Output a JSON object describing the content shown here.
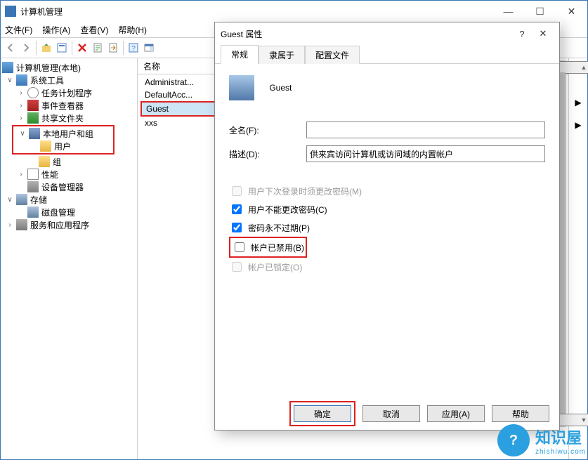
{
  "window": {
    "title": "计算机管理",
    "menus": [
      "文件(F)",
      "操作(A)",
      "查看(V)",
      "帮助(H)"
    ]
  },
  "tree": {
    "root": "计算机管理(本地)",
    "system_tools": "系统工具",
    "task_scheduler": "任务计划程序",
    "event_viewer": "事件查看器",
    "shared_folders": "共享文件夹",
    "local_users_groups": "本地用户和组",
    "users": "用户",
    "groups": "组",
    "performance": "性能",
    "device_manager": "设备管理器",
    "storage": "存储",
    "disk_management": "磁盘管理",
    "services_apps": "服务和应用程序"
  },
  "list": {
    "header_name": "名称",
    "items": [
      "Administrat...",
      "DefaultAcc...",
      "Guest",
      "xxs"
    ],
    "selected": "Guest"
  },
  "dialog": {
    "title": "Guest 属性",
    "tabs": [
      "常规",
      "隶属于",
      "配置文件"
    ],
    "hero_name": "Guest",
    "full_name_label": "全名(F):",
    "full_name_value": "",
    "description_label": "描述(D):",
    "description_value": "供来宾访问计算机或访问域的内置帐户",
    "checks": {
      "must_change": {
        "label": "用户下次登录时须更改密码(M)",
        "checked": false,
        "disabled": true
      },
      "cannot_change": {
        "label": "用户不能更改密码(C)",
        "checked": true,
        "disabled": false
      },
      "never_expire": {
        "label": "密码永不过期(P)",
        "checked": true,
        "disabled": false
      },
      "disabled": {
        "label": "帐户已禁用(B)",
        "checked": false,
        "disabled": false
      },
      "locked": {
        "label": "帐户已锁定(O)",
        "checked": false,
        "disabled": true
      }
    },
    "buttons": {
      "ok": "确定",
      "cancel": "取消",
      "apply": "应用(A)",
      "help": "帮助"
    }
  },
  "watermark": {
    "brand": "知识屋",
    "url": "zhishiwu.com"
  }
}
